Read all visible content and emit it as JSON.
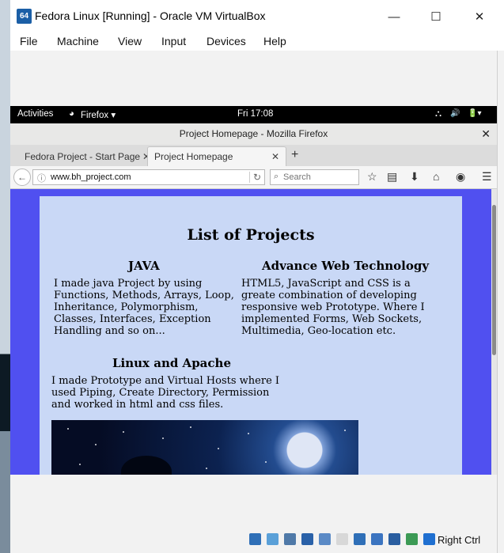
{
  "vbox": {
    "title": "Fedora Linux [Running] - Oracle VM VirtualBox",
    "logo_text": "64",
    "window_buttons": {
      "minimize": "—",
      "maximize": "☐",
      "close": "✕"
    },
    "menu": [
      "File",
      "Machine",
      "View",
      "Input",
      "Devices",
      "Help"
    ],
    "host_key": "Right Ctrl"
  },
  "gnome": {
    "activities": "Activities",
    "app": "Firefox ▾",
    "clock": "Fri 17:08",
    "tray": {
      "network": "⛬",
      "volume": "🔊",
      "battery": "🔋▾"
    }
  },
  "firefox": {
    "window_title": "Project Homepage - Mozilla Firefox",
    "close_glyph": "✕",
    "tabs": [
      {
        "label": "Fedora Project - Start Page",
        "close": "✕"
      },
      {
        "label": "Project Homepage",
        "close": "✕"
      }
    ],
    "new_tab_glyph": "+",
    "back_glyph": "←",
    "info_glyph": "ⓘ",
    "url": "www.bh_project.com",
    "reload_glyph": "↻",
    "search_placeholder": "Search",
    "search_glyph": "⌕",
    "toolbar_icons": {
      "bookmark": "☆",
      "library": "▤",
      "download": "⬇",
      "home": "⌂",
      "pocket": "◉",
      "menu": "☰"
    }
  },
  "page": {
    "title": "List of Projects",
    "sections": {
      "java": {
        "heading": "JAVA",
        "text": "I made java Project by using Functions, Methods, Arrays, Loop, Inheritance, Polymorphism, Classes, Interfaces, Exception Handling and so on..."
      },
      "web": {
        "heading": "Advance Web Technology",
        "text": "HTML5, JavaScript and CSS is a greate combination of developing responsive web Prototype. Where I implemented Forms, Web Sockets, Multimedia, Geo-location etc."
      },
      "linux": {
        "heading": "Linux and Apache",
        "text": "I made Prototype and Virtual Hosts where I used Piping, Create Directory, Permission and worked in html and css files."
      }
    }
  },
  "status_icons": [
    {
      "name": "hard-disk-icon",
      "color": "#2f6fb7"
    },
    {
      "name": "optical-drive-icon",
      "color": "#5aa0d8"
    },
    {
      "name": "audio-icon",
      "color": "#4f79a8"
    },
    {
      "name": "network-icon",
      "color": "#2a61a8"
    },
    {
      "name": "usb-icon",
      "color": "#5b8ac6"
    },
    {
      "name": "shared-folders-icon",
      "color": "#d8d8d8"
    },
    {
      "name": "display-icon",
      "color": "#2f6fb7"
    },
    {
      "name": "video-capture-icon",
      "color": "#3b74c0"
    },
    {
      "name": "cpu-icon",
      "color": "#2a5ea0"
    },
    {
      "name": "mouse-integration-icon",
      "color": "#3c9a55"
    },
    {
      "name": "keyboard-capture-icon",
      "color": "#1f6fd0"
    }
  ]
}
